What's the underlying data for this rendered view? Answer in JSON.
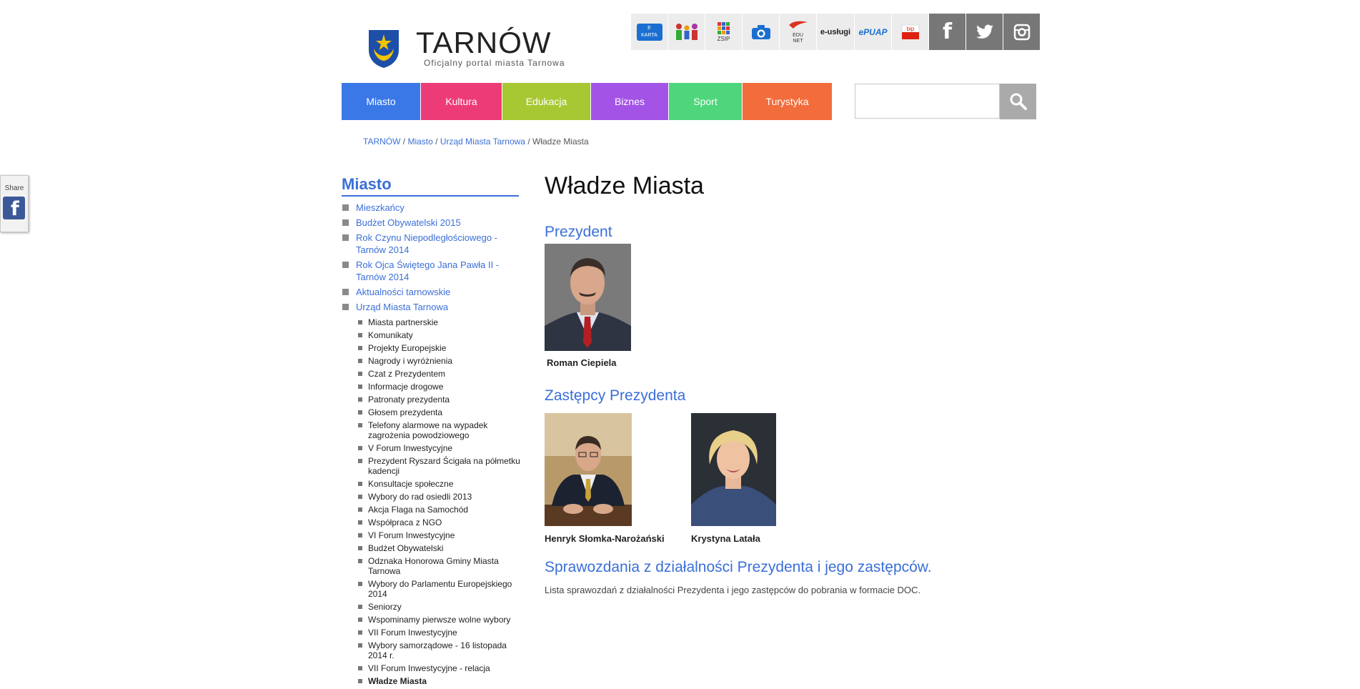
{
  "share": {
    "label": "Share",
    "icon": "facebook-icon"
  },
  "header": {
    "title": "TARNÓW",
    "subtitle": "Oficjalny portal miasta Tarnowa",
    "service_icons": [
      {
        "name": "e-karta-icon",
        "label": "E KARTA"
      },
      {
        "name": "family-icon",
        "label": ""
      },
      {
        "name": "zsip-icon",
        "label": "ZSIP"
      },
      {
        "name": "camera-icon",
        "label": ""
      },
      {
        "name": "edu-net-icon",
        "label": "EDU NET"
      },
      {
        "name": "e-uslugi-icon",
        "label": "e-usługi"
      },
      {
        "name": "epuap-icon",
        "label": "ePUAP"
      },
      {
        "name": "bip-icon",
        "label": "bip"
      }
    ],
    "social": [
      "facebook-icon",
      "twitter-icon",
      "instagram-icon"
    ]
  },
  "nav": [
    {
      "label": "Miasto",
      "color": "#3b78e7"
    },
    {
      "label": "Kultura",
      "color": "#ed3b78"
    },
    {
      "label": "Edukacja",
      "color": "#a8c833"
    },
    {
      "label": "Biznes",
      "color": "#a353e6"
    },
    {
      "label": "Sport",
      "color": "#4fd57b"
    },
    {
      "label": "Turystyka",
      "color": "#f36c3c"
    }
  ],
  "search": {
    "placeholder": ""
  },
  "breadcrumb": {
    "items": [
      "TARNÓW",
      "Miasto",
      "Urząd Miasta Tarnowa"
    ],
    "current": "Władze Miasta",
    "sep": " / "
  },
  "sidebar": {
    "title": "Miasto",
    "items": [
      "Mieszkańcy",
      "Budżet Obywatelski 2015",
      "Rok Czynu Niepodległościowego - Tarnów 2014",
      "Rok Ojca Świętego Jana Pawła II - Tarnów 2014",
      "Aktualności tarnowskie",
      "Urząd Miasta Tarnowa"
    ],
    "subitems": [
      "Miasta partnerskie",
      "Komunikaty",
      "Projekty Europejskie",
      "Nagrody i wyróżnienia",
      "Czat z Prezydentem",
      "Informacje drogowe",
      "Patronaty prezydenta",
      "Głosem prezydenta",
      "Telefony alarmowe na wypadek zagrożenia powodziowego",
      "V Forum Inwestycyjne",
      "Prezydent Ryszard Ścigała na półmetku kadencji",
      "Konsultacje społeczne",
      "Wybory do rad osiedli 2013",
      "Akcja Flaga na Samochód",
      "Współpraca z NGO",
      "VI Forum Inwestycyjne",
      "Budżet Obywatelski",
      "Odznaka Honorowa Gminy Miasta Tarnowa",
      "Wybory do Parlamentu Europejskiego 2014",
      "Seniorzy",
      "Wspominamy pierwsze wolne wybory",
      "VII Forum Inwestycyjne",
      "Wybory samorządowe - 16 listopada 2014 r.",
      "VII Forum Inwestycyjne - relacja",
      "Władze Miasta"
    ]
  },
  "main": {
    "title": "Władze Miasta",
    "president_heading": "Prezydent",
    "president": "Roman Ciepiela",
    "deputies_heading": "Zastępcy Prezydenta",
    "deputies": [
      "Henryk Słomka-Narożański",
      "Krystyna Latała"
    ],
    "reports_heading": "Sprawozdania z działalności Prezydenta i jego zastępców.",
    "reports_text": "Lista sprawozdań z działalności Prezydenta i jego zastępców do pobrania w formacie DOC."
  }
}
